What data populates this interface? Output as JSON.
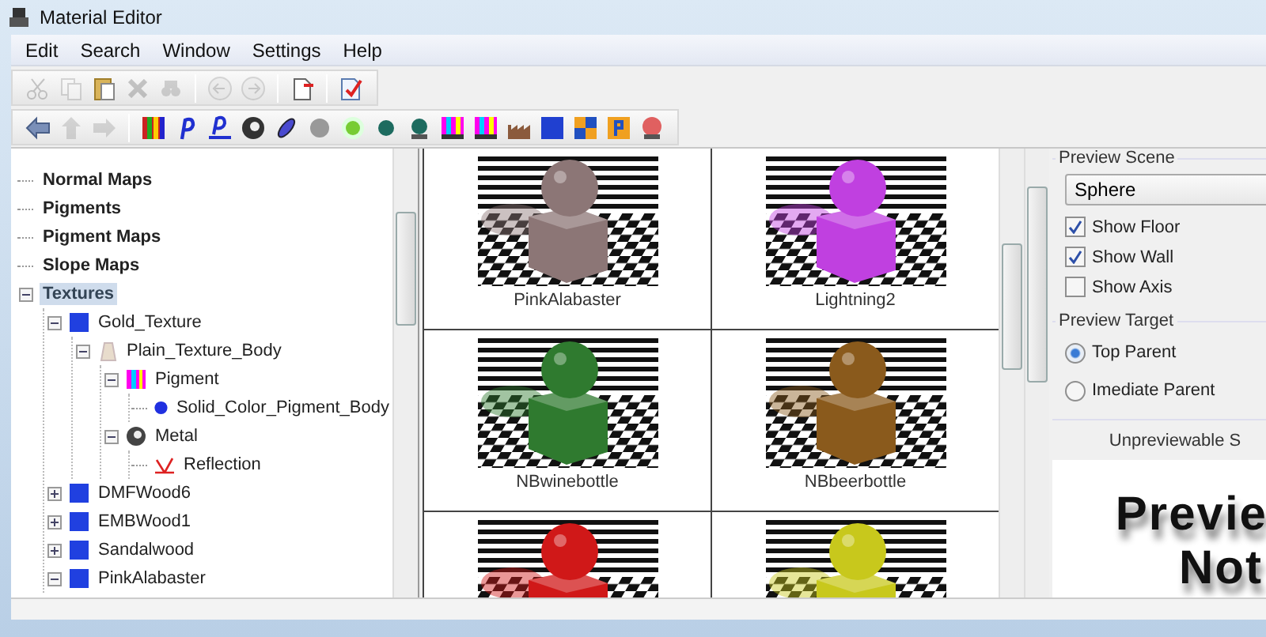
{
  "window": {
    "title": "Material Editor"
  },
  "menu": [
    "Edit",
    "Search",
    "Window",
    "Settings",
    "Help"
  ],
  "toolbars": [
    [
      {
        "kind": "cut",
        "disabled": true
      },
      {
        "kind": "copy",
        "disabled": true
      },
      {
        "kind": "paste",
        "disabled": false
      },
      {
        "kind": "delete",
        "disabled": true
      },
      {
        "kind": "find",
        "disabled": true
      },
      {
        "kind": "separator"
      },
      {
        "kind": "undo",
        "disabled": true
      },
      {
        "kind": "redo",
        "disabled": true
      },
      {
        "kind": "separator"
      },
      {
        "kind": "new",
        "disabled": false
      },
      {
        "kind": "separator"
      },
      {
        "kind": "check",
        "disabled": false
      }
    ],
    [
      {
        "kind": "back",
        "disabled": false
      },
      {
        "kind": "up",
        "disabled": true
      },
      {
        "kind": "forward",
        "disabled": true
      },
      {
        "kind": "separator"
      },
      {
        "kind": "texture",
        "disabled": false
      },
      {
        "kind": "pigment",
        "disabled": false
      },
      {
        "kind": "pigment-map",
        "disabled": false
      },
      {
        "kind": "finish",
        "disabled": false
      },
      {
        "kind": "normal",
        "disabled": false
      },
      {
        "kind": "grey-sphere",
        "disabled": false
      },
      {
        "kind": "glow",
        "disabled": false
      },
      {
        "kind": "dot",
        "disabled": false
      },
      {
        "kind": "pawn",
        "disabled": false
      },
      {
        "kind": "stripes",
        "disabled": false
      },
      {
        "kind": "stripes",
        "disabled": false
      },
      {
        "kind": "factory",
        "disabled": false
      },
      {
        "kind": "blue-square",
        "disabled": false
      },
      {
        "kind": "checker",
        "disabled": false
      },
      {
        "kind": "map",
        "disabled": false
      },
      {
        "kind": "lamp",
        "disabled": false
      }
    ]
  ],
  "tree": {
    "items": [
      {
        "label": "Normal Maps",
        "kind": "category",
        "selected": false
      },
      {
        "label": "Pigments",
        "kind": "category",
        "selected": false
      },
      {
        "label": "Pigment Maps",
        "kind": "category",
        "selected": false
      },
      {
        "label": "Slope Maps",
        "kind": "category",
        "selected": false
      },
      {
        "label": "Textures",
        "kind": "category",
        "selected": true,
        "expanded": true,
        "children": [
          {
            "label": "Gold_Texture",
            "kind": "texture",
            "selected": false,
            "expanded": true,
            "children": [
              {
                "label": "Plain_Texture_Body",
                "kind": "body",
                "selected": false,
                "expanded": true,
                "children": [
                  {
                    "label": "Pigment",
                    "kind": "pigment",
                    "selected": false,
                    "expanded": true,
                    "children": [
                      {
                        "label": "Solid_Color_Pigment_Body",
                        "kind": "solid",
                        "selected": false
                      }
                    ]
                  },
                  {
                    "label": "Metal",
                    "kind": "finish",
                    "selected": false,
                    "expanded": true,
                    "children": [
                      {
                        "label": "Reflection",
                        "kind": "reflection",
                        "selected": false
                      }
                    ]
                  }
                ]
              }
            ]
          },
          {
            "label": "DMFWood6",
            "kind": "texture",
            "selected": false,
            "expanded": false
          },
          {
            "label": "EMBWood1",
            "kind": "texture",
            "selected": false,
            "expanded": false
          },
          {
            "label": "Sandalwood",
            "kind": "texture",
            "selected": false,
            "expanded": false
          },
          {
            "label": "PinkAlabaster",
            "kind": "texture",
            "selected": false,
            "expanded": true
          }
        ]
      }
    ]
  },
  "gallery": {
    "items": [
      {
        "label": "PinkAlabaster",
        "color": "#8c7676"
      },
      {
        "label": "Lightning2",
        "color": "#c040e0"
      },
      {
        "label": "NBwinebottle",
        "color": "#2f7a2f"
      },
      {
        "label": "NBbeerbottle",
        "color": "#8a5a1c"
      },
      {
        "color": "#d01818"
      },
      {
        "color": "#c8c81c"
      }
    ]
  },
  "preview_scene": {
    "title": "Preview Scene",
    "scene": "Sphere",
    "options": [
      {
        "label": "Show Floor",
        "checked": true
      },
      {
        "label": "Show Wall",
        "checked": true
      },
      {
        "label": "Show Axis",
        "checked": false
      }
    ]
  },
  "preview_target": {
    "title": "Preview Target",
    "options": [
      {
        "label": "Top Parent",
        "selected": true
      },
      {
        "label": "Imediate Parent",
        "selected": false
      }
    ]
  },
  "unpreviewable": {
    "label": "Unpreviewable S",
    "lines": [
      "Previe",
      "Not"
    ]
  }
}
